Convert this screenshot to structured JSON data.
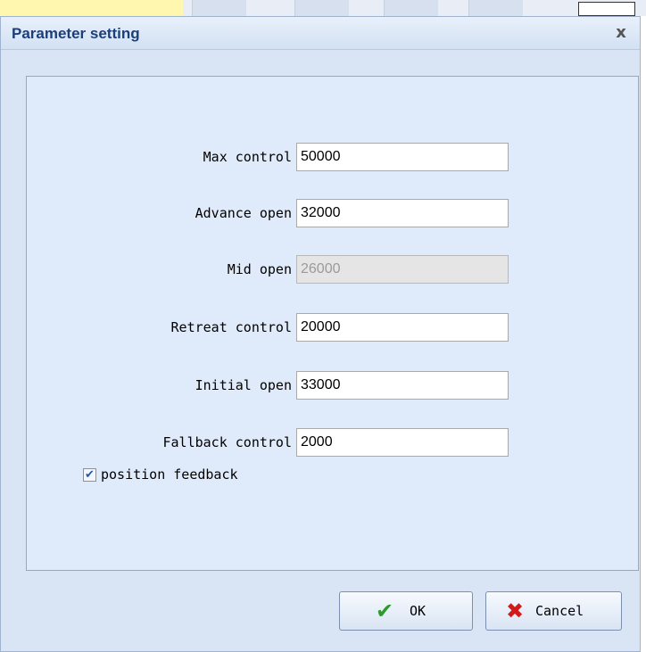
{
  "dialog": {
    "title": "Parameter setting",
    "close_glyph": "x"
  },
  "fields": [
    {
      "label": "Max control",
      "value": "50000",
      "disabled": false
    },
    {
      "label": "Advance open",
      "value": "32000",
      "disabled": false
    },
    {
      "label": "Mid open",
      "value": "26000",
      "disabled": true
    },
    {
      "label": "Retreat control",
      "value": "20000",
      "disabled": false
    },
    {
      "label": "Initial open",
      "value": "33000",
      "disabled": false
    },
    {
      "label": "Fallback control",
      "value": "2000",
      "disabled": false
    }
  ],
  "checkbox": {
    "label": "position feedback",
    "checked": true
  },
  "buttons": {
    "ok_label": "OK",
    "ok_icon": "checkmark-icon",
    "cancel_label": "Cancel",
    "cancel_icon": "red-x-icon"
  },
  "colors": {
    "title_text": "#1b3f78",
    "dialog_bg": "#d9e5f5",
    "ok_icon": "#2e9a2e",
    "cancel_icon": "#d11a1a"
  }
}
